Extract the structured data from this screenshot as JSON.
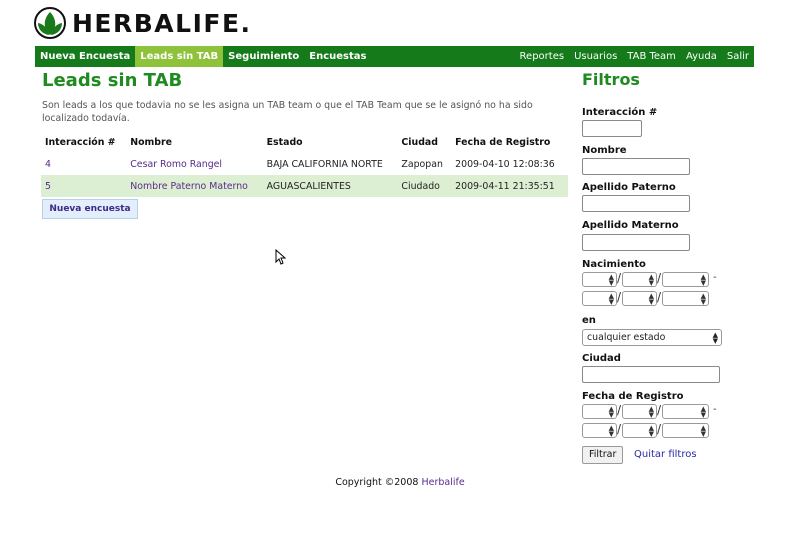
{
  "brand": {
    "name": "HERBALIFE."
  },
  "nav": {
    "left": [
      "Nueva Encuesta",
      "Leads sin TAB",
      "Seguimiento",
      "Encuestas"
    ],
    "active": "Leads sin TAB",
    "right": [
      "Reportes",
      "Usuarios",
      "TAB Team",
      "Ayuda",
      "Salir"
    ]
  },
  "page": {
    "title": "Leads sin TAB",
    "description": "Son leads a los que todavia no se les asigna un TAB team o que el TAB Team que se le asignó no ha sido localizado todavía."
  },
  "table": {
    "headers": [
      "Interacción #",
      "Nombre",
      "Estado",
      "Ciudad",
      "Fecha de Registro"
    ],
    "rows": [
      [
        "4",
        "Cesar Romo Rangel",
        "BAJA CALIFORNIA NORTE",
        "Zapopan",
        "2009-04-10 12:08:36"
      ],
      [
        "5",
        "Nombre Paterno Materno",
        "AGUASCALIENTES",
        "Ciudado",
        "2009-04-11 21:35:51"
      ]
    ]
  },
  "new_button": "Nueva encuesta",
  "filters": {
    "title": "Filtros",
    "interaccion_label": "Interacción #",
    "nombre_label": "Nombre",
    "paterno_label": "Apellido Paterno",
    "materno_label": "Apellido Materno",
    "nacimiento_label": "Nacimiento",
    "en_label": "en",
    "estado_value": "cualquier estado",
    "ciudad_label": "Ciudad",
    "fecha_label": "Fecha de Registro",
    "filtrar_button": "Filtrar",
    "quitar_link": "Quitar filtros"
  },
  "footer": {
    "text": "Copyright ©2008 ",
    "link": "Herbalife"
  },
  "colors": {
    "nav_bg": "#157a1a",
    "nav_active": "#8fc23b",
    "heading": "#1f8a1f",
    "row_alt": "#ddefd3"
  }
}
